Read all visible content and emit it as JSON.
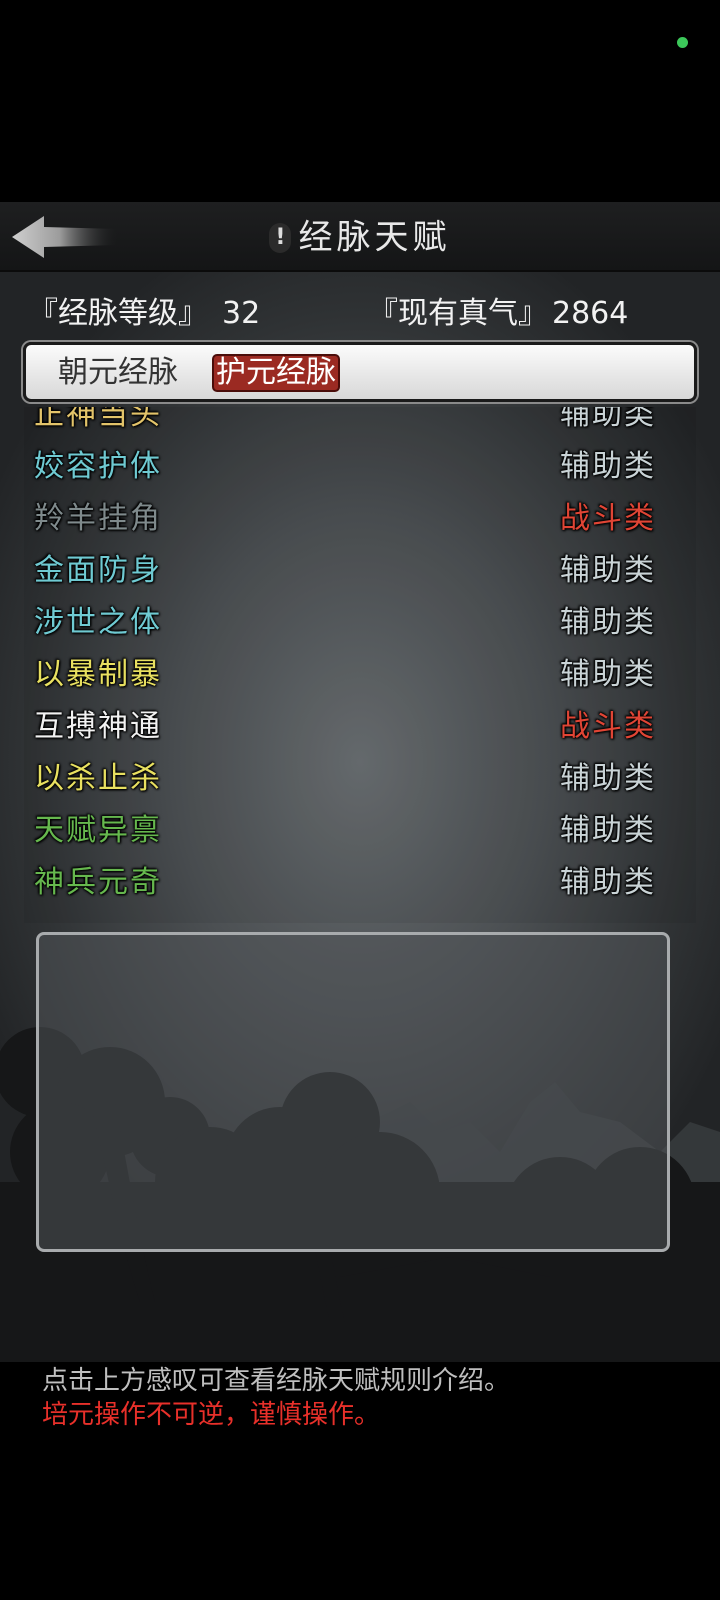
{
  "header": {
    "title": "经脉天赋",
    "info_symbol": "!"
  },
  "stats": {
    "level_label": "『经脉等级』",
    "level_value": "32",
    "qi_label": "『现有真气』",
    "qi_value": "2864"
  },
  "tabs": [
    {
      "label": "朝元经脉",
      "selected": false
    },
    {
      "label": "护元经脉",
      "selected": true
    }
  ],
  "talents": [
    {
      "name": "正神当头",
      "category": "辅助类",
      "name_color": "#e3c46a",
      "category_color": "#c9d3d6"
    },
    {
      "name": "姣容护体",
      "category": "辅助类",
      "name_color": "#6fcad2",
      "category_color": "#c9d3d6"
    },
    {
      "name": "羚羊挂角",
      "category": "战斗类",
      "name_color": "#7f8a8c",
      "category_color": "#e04535"
    },
    {
      "name": "金面防身",
      "category": "辅助类",
      "name_color": "#6fcad2",
      "category_color": "#c9d3d6"
    },
    {
      "name": "涉世之体",
      "category": "辅助类",
      "name_color": "#6fcad2",
      "category_color": "#c9d3d6"
    },
    {
      "name": "以暴制暴",
      "category": "辅助类",
      "name_color": "#e8e060",
      "category_color": "#c9d3d6"
    },
    {
      "name": "互搏神通",
      "category": "战斗类",
      "name_color": "#f2f2f2",
      "category_color": "#e04535"
    },
    {
      "name": "以杀止杀",
      "category": "辅助类",
      "name_color": "#e8e060",
      "category_color": "#c9d3d6"
    },
    {
      "name": "天赋异禀",
      "category": "辅助类",
      "name_color": "#66b84e",
      "category_color": "#c9d3d6"
    },
    {
      "name": "神兵元奇",
      "category": "辅助类",
      "name_color": "#66b84e",
      "category_color": "#c9d3d6"
    }
  ],
  "notes": {
    "hint": "点击上方感叹可查看经脉天赋规则介绍。",
    "warning": "培元操作不可逆，谨慎操作。",
    "hint_color": "#bfbfbf",
    "warning_color": "#e8302a"
  }
}
